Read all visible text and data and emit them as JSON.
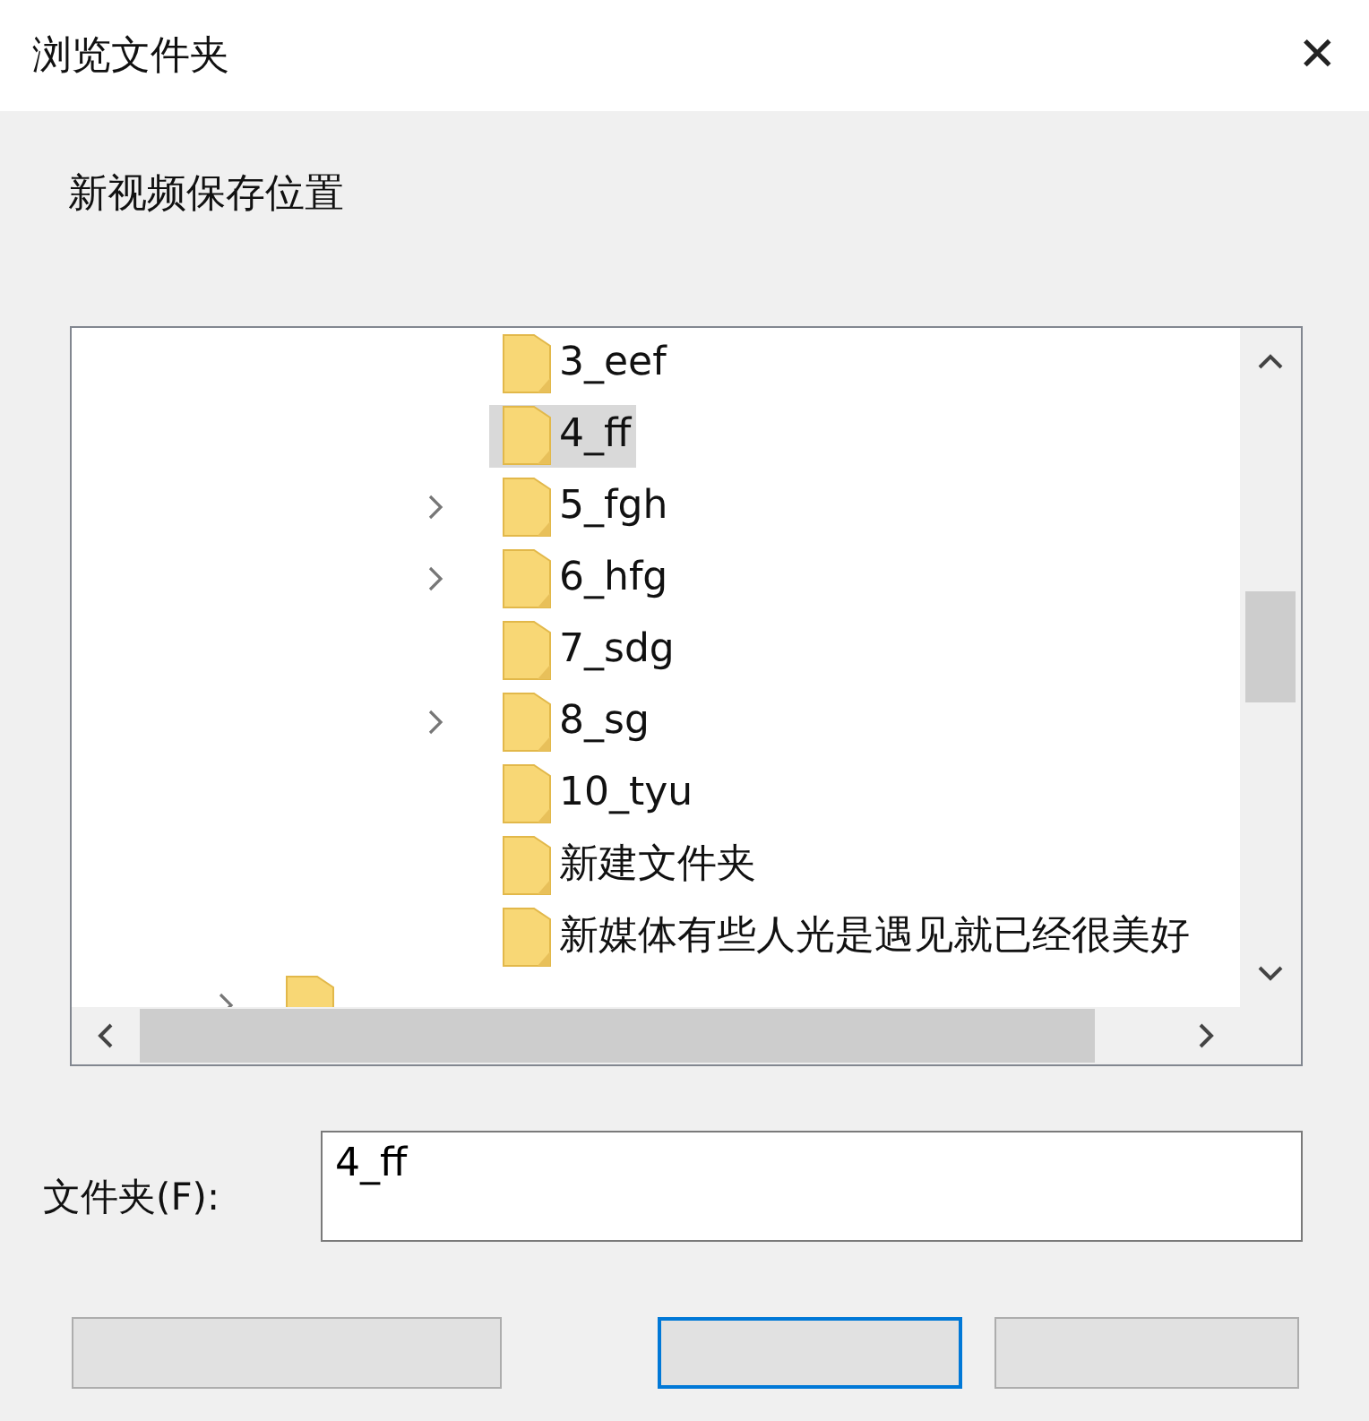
{
  "window": {
    "title": "浏览文件夹",
    "close": "✕"
  },
  "description": "新视频保存位置",
  "tree": {
    "folders": [
      {
        "label": "3_eef",
        "expandable": false,
        "selected": false
      },
      {
        "label": "4_ff",
        "expandable": false,
        "selected": true
      },
      {
        "label": "5_fgh",
        "expandable": true,
        "selected": false
      },
      {
        "label": "6_hfg",
        "expandable": true,
        "selected": false
      },
      {
        "label": "7_sdg",
        "expandable": false,
        "selected": false
      },
      {
        "label": "8_sg",
        "expandable": true,
        "selected": false
      },
      {
        "label": "10_tyu",
        "expandable": false,
        "selected": false
      },
      {
        "label": "新建文件夹",
        "expandable": false,
        "selected": false
      },
      {
        "label": "新媒体有些人光是遇见就已经很美好",
        "expandable": false,
        "selected": false
      }
    ],
    "cut_off_folder": {
      "expandable": true
    }
  },
  "folder_field": {
    "label": "文件夹(F):",
    "value": "4_ff"
  },
  "buttons": [
    {
      "default": false
    },
    {
      "default": true
    },
    {
      "default": false
    }
  ]
}
